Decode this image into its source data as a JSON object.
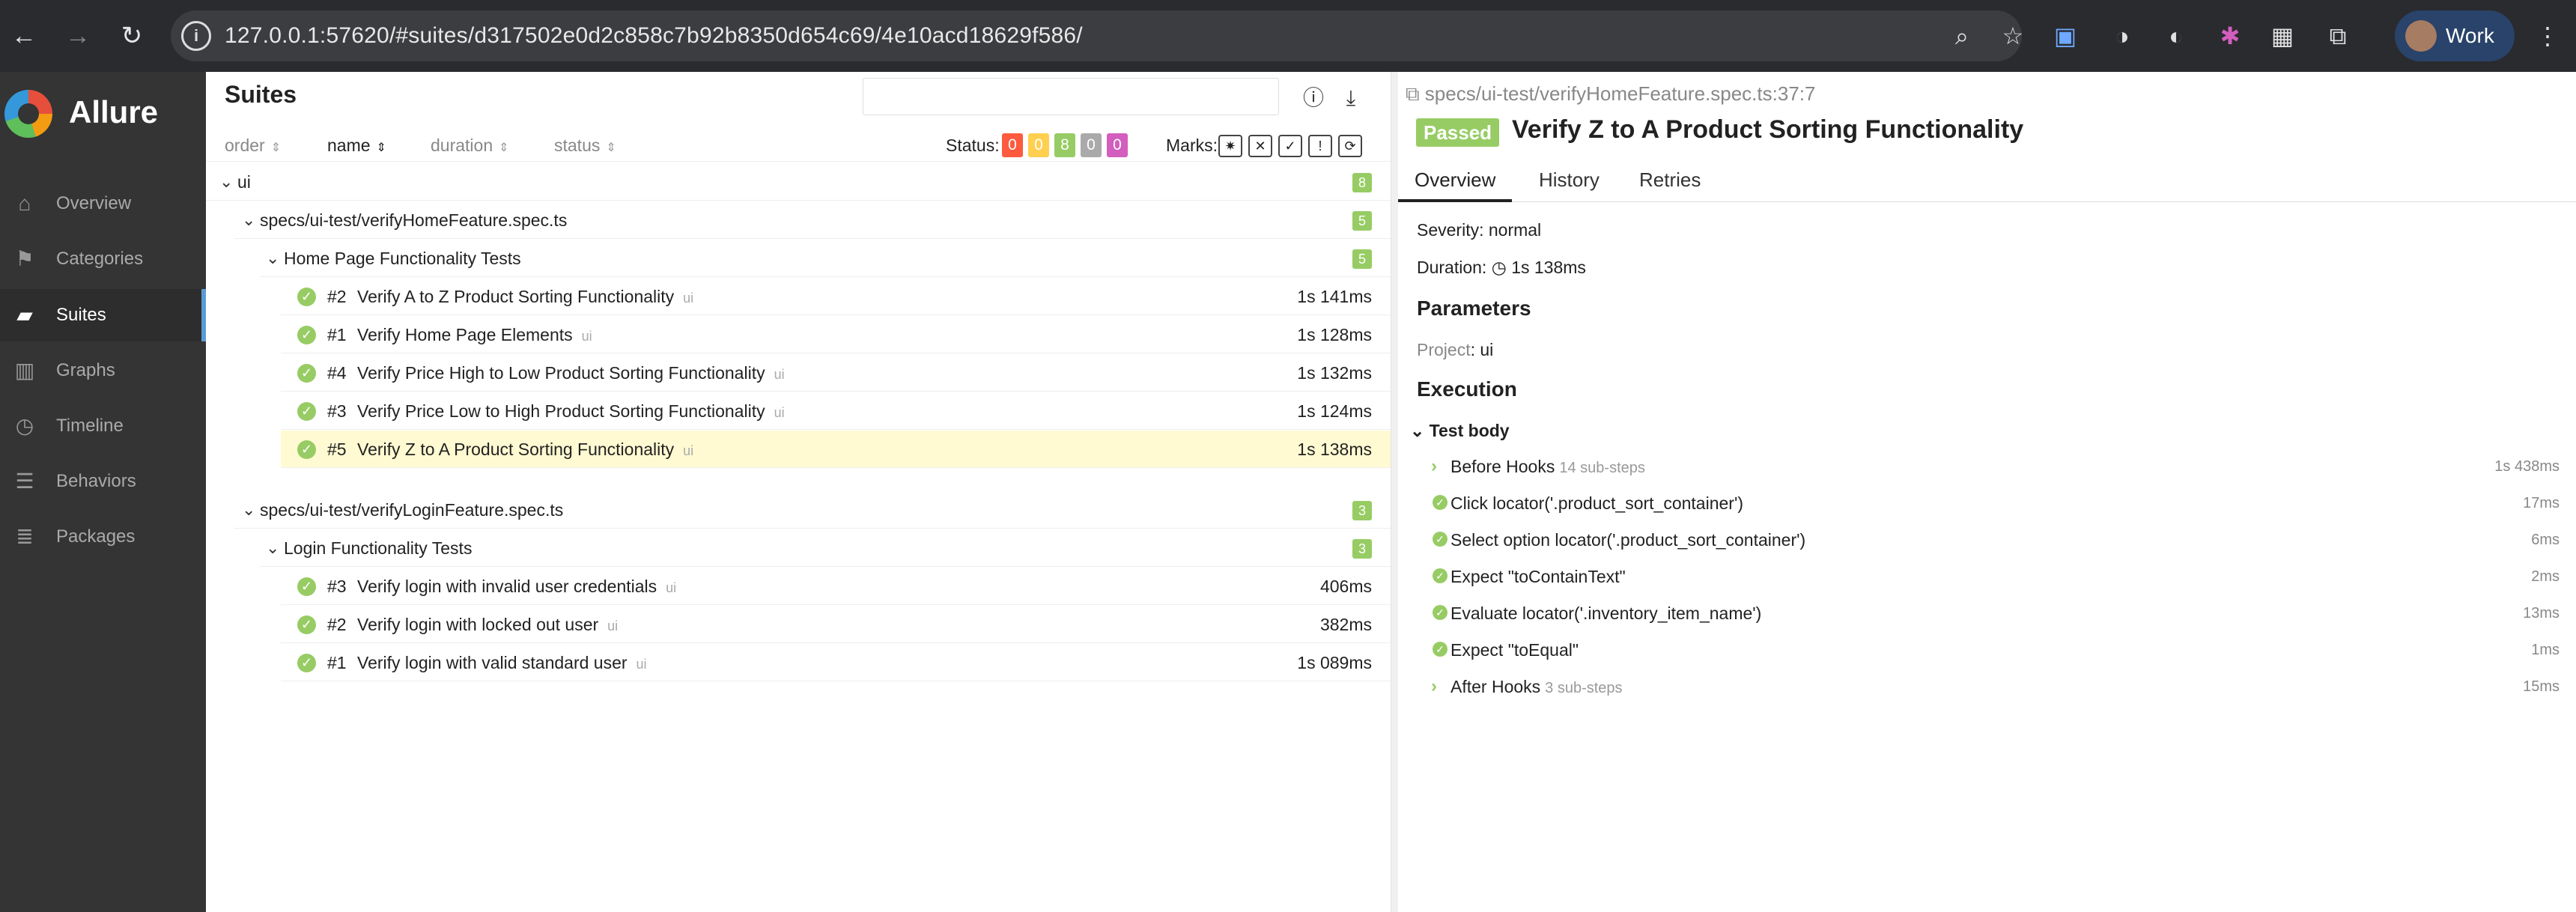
{
  "browser": {
    "url": "127.0.0.1:57620/#suites/d317502e0d2c858c7b92b8350d654c69/4e10acd18629f586/",
    "profile_name": "Work",
    "nav": {
      "back": "←",
      "forward": "→",
      "reload": "↻"
    }
  },
  "app": {
    "name": "Allure"
  },
  "sidebar": {
    "items": [
      {
        "label": "Overview",
        "icon": "home-icon"
      },
      {
        "label": "Categories",
        "icon": "flag-icon"
      },
      {
        "label": "Suites",
        "icon": "briefcase-icon",
        "active": true
      },
      {
        "label": "Graphs",
        "icon": "bar-chart-icon"
      },
      {
        "label": "Timeline",
        "icon": "clock-icon"
      },
      {
        "label": "Behaviors",
        "icon": "list-icon"
      },
      {
        "label": "Packages",
        "icon": "align-left-icon"
      }
    ]
  },
  "suites": {
    "title": "Suites",
    "columns": [
      "order",
      "name",
      "duration",
      "status"
    ],
    "status_label": "Status:",
    "status_counts": [
      "0",
      "0",
      "8",
      "0",
      "0"
    ],
    "marks_label": "Marks:",
    "root": {
      "name": "ui",
      "count": "8"
    },
    "groups": [
      {
        "file": "specs/ui-test/verifyHomeFeature.spec.ts",
        "count": "5",
        "suite": "Home Page Functionality Tests",
        "suite_count": "5",
        "tests": [
          {
            "order": "#2",
            "title": "Verify A to Z Product Sorting Functionality",
            "tag": "ui",
            "duration": "1s 141ms"
          },
          {
            "order": "#1",
            "title": "Verify Home Page Elements",
            "tag": "ui",
            "duration": "1s 128ms"
          },
          {
            "order": "#4",
            "title": "Verify Price High to Low Product Sorting Functionality",
            "tag": "ui",
            "duration": "1s 132ms"
          },
          {
            "order": "#3",
            "title": "Verify Price Low to High Product Sorting Functionality",
            "tag": "ui",
            "duration": "1s 124ms"
          },
          {
            "order": "#5",
            "title": "Verify Z to A Product Sorting Functionality",
            "tag": "ui",
            "duration": "1s 138ms",
            "selected": true
          }
        ]
      },
      {
        "file": "specs/ui-test/verifyLoginFeature.spec.ts",
        "count": "3",
        "suite": "Login Functionality Tests",
        "suite_count": "3",
        "tests": [
          {
            "order": "#3",
            "title": "Verify login with invalid user credentials",
            "tag": "ui",
            "duration": "406ms"
          },
          {
            "order": "#2",
            "title": "Verify login with locked out user",
            "tag": "ui",
            "duration": "382ms"
          },
          {
            "order": "#1",
            "title": "Verify login with valid standard user",
            "tag": "ui",
            "duration": "1s 089ms"
          }
        ]
      }
    ]
  },
  "detail": {
    "spec_path": "specs/ui-test/verifyHomeFeature.spec.ts:37:7",
    "status": "Passed",
    "title": "Verify Z to A Product Sorting Functionality",
    "tabs": [
      "Overview",
      "History",
      "Retries"
    ],
    "severity": "Severity: normal",
    "duration_label": "Duration:",
    "duration": "1s 138ms",
    "parameters_heading": "Parameters",
    "param_key": "Project",
    "param_value": "ui",
    "execution_heading": "Execution",
    "test_body": "Test body",
    "steps": [
      {
        "label": "Before Hooks",
        "sub": "14 sub-steps",
        "duration": "1s 438ms",
        "kind": "group"
      },
      {
        "label": "Click locator('.product_sort_container')",
        "duration": "17ms",
        "kind": "step"
      },
      {
        "label": "Select option locator('.product_sort_container')",
        "duration": "6ms",
        "kind": "step"
      },
      {
        "label": "Expect \"toContainText\"",
        "duration": "2ms",
        "kind": "step"
      },
      {
        "label": "Evaluate locator('.inventory_item_name')",
        "duration": "13ms",
        "kind": "step"
      },
      {
        "label": "Expect \"toEqual\"",
        "duration": "1ms",
        "kind": "step"
      },
      {
        "label": "After Hooks",
        "sub": "3 sub-steps",
        "duration": "15ms",
        "kind": "group"
      }
    ]
  },
  "colors": {
    "passed": "#97cc64",
    "failed": "#fd5a3e",
    "broken": "#ffd050",
    "skipped": "#aaaaaa",
    "unknown": "#d35ebe"
  }
}
